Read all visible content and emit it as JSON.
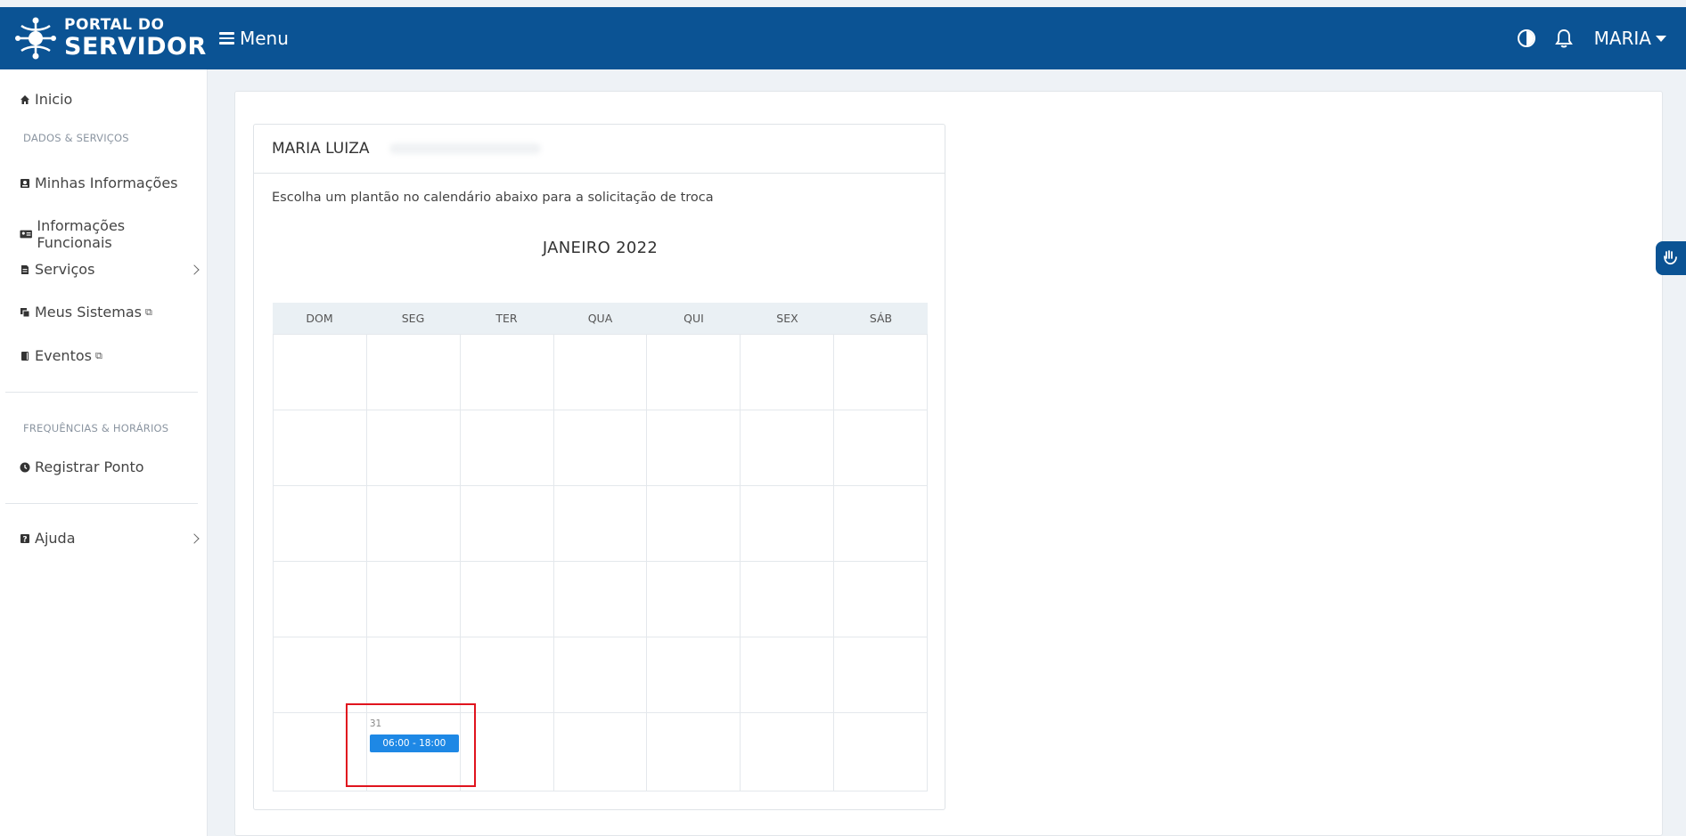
{
  "header": {
    "logo_line1": "PORTAL DO",
    "logo_line2": "SERVIDOR",
    "menu_label": "Menu",
    "user_name": "MARIA",
    "brand_color": "#0b5394"
  },
  "sidebar": {
    "home": "Inicio",
    "section_data": "DADOS & SERVIÇOS",
    "minhas_informacoes": "Minhas Informações",
    "informacoes_funcionais": "Informações Funcionais",
    "servicos": "Serviços",
    "meus_sistemas": "Meus Sistemas",
    "eventos": "Eventos",
    "section_freq": "FREQUÊNCIAS & HORÁRIOS",
    "registrar_ponto": "Registrar Ponto",
    "ajuda": "Ajuda"
  },
  "card": {
    "employee_name": "MARIA LUIZA",
    "instruction": "Escolha um plantão no calendário abaixo para a solicitação de troca",
    "month_title": "JANEIRO 2022"
  },
  "calendar": {
    "weekdays": [
      "DOM",
      "SEG",
      "TER",
      "QUA",
      "QUI",
      "SEX",
      "SÁB"
    ],
    "highlight_day": "31",
    "event_label": "06:00 - 18:00",
    "event_color": "#1e88e5"
  }
}
